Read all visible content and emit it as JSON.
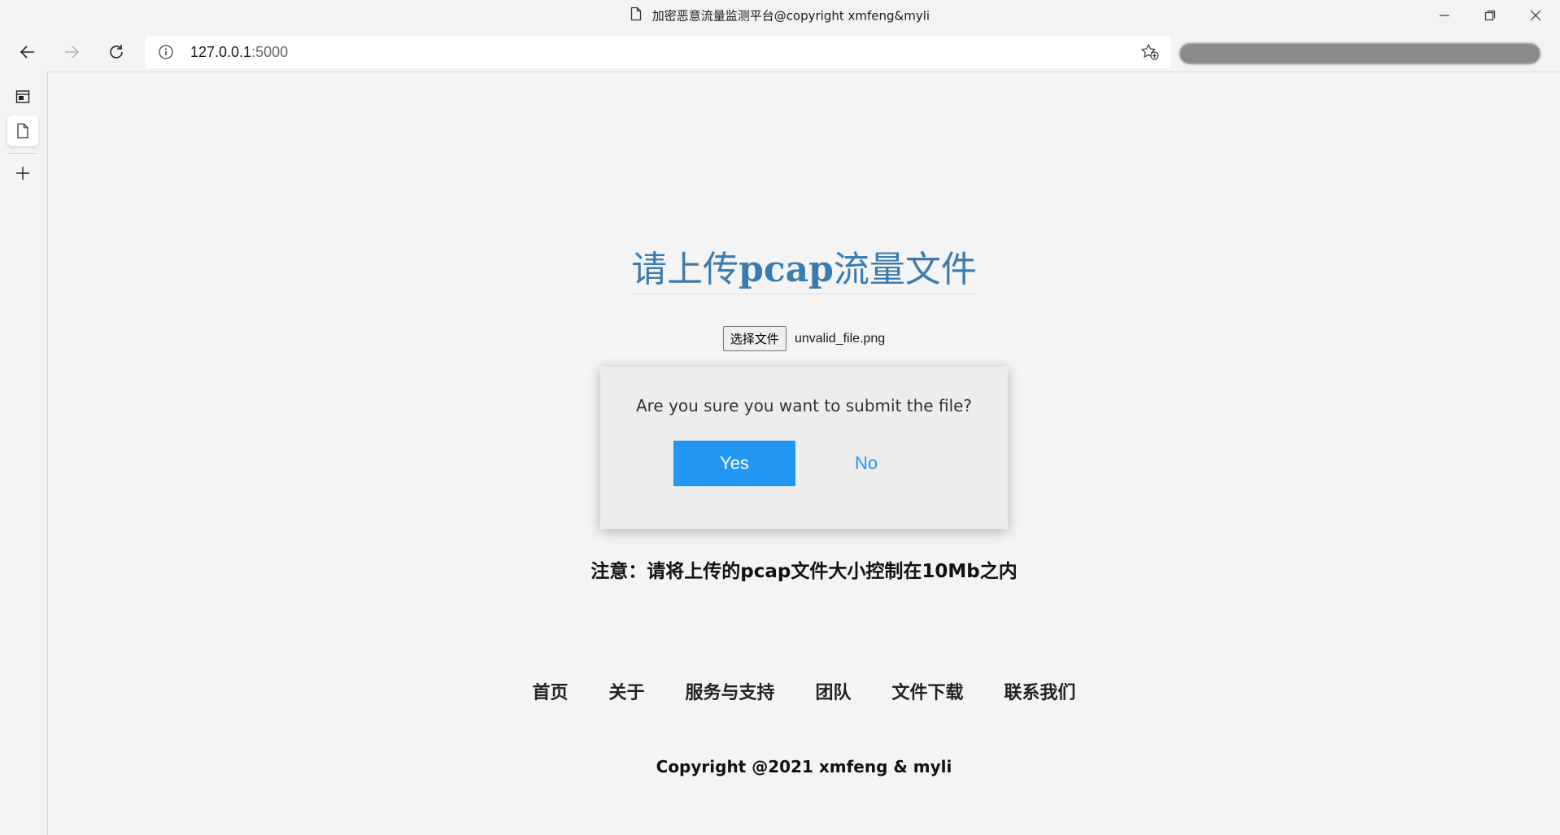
{
  "browser": {
    "tab_title": "加密恶意流量监测平台@copyright xmfeng&myli",
    "address": {
      "host": "127.0.0.1",
      "port": ":5000"
    }
  },
  "page": {
    "heading_prefix": "请上传",
    "heading_bold": "pcap",
    "heading_suffix": "流量文件",
    "file_input": {
      "button_label": "选择文件",
      "file_name": "unvalid_file.png"
    },
    "dialog": {
      "message": "Are you sure you want to submit the file?",
      "yes_label": "Yes",
      "no_label": "No"
    },
    "notice": "注意：请将上传的pcap文件大小控制在10Mb之内",
    "nav": [
      {
        "label": "首页"
      },
      {
        "label": "关于"
      },
      {
        "label": "服务与支持"
      },
      {
        "label": "团队"
      },
      {
        "label": "文件下载"
      },
      {
        "label": "联系我们"
      }
    ],
    "copyright": "Copyright @2021 xmfeng & myli"
  },
  "colors": {
    "heading": "#3a7cb0",
    "primary_button": "#2196f3"
  }
}
